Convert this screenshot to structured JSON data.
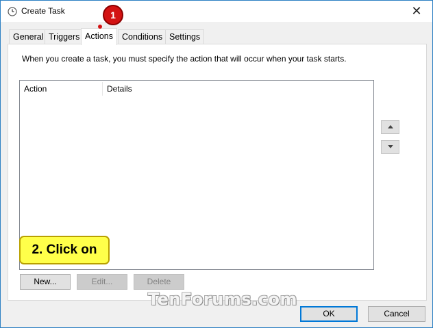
{
  "window": {
    "title": "Create Task",
    "close_glyph": "✕"
  },
  "tabs": [
    {
      "label": "General"
    },
    {
      "label": "Triggers"
    },
    {
      "label": "Actions",
      "active": true
    },
    {
      "label": "Conditions"
    },
    {
      "label": "Settings"
    }
  ],
  "panel": {
    "description": "When you create a task, you must specify the action that will occur when your task starts.",
    "columns": [
      "Action",
      "Details"
    ],
    "rows": []
  },
  "buttons": {
    "new": "New...",
    "edit": "Edit...",
    "delete": "Delete",
    "ok": "OK",
    "cancel": "Cancel"
  },
  "annotations": {
    "step1": "1",
    "step2": "2. Click on"
  },
  "watermark": "TenForums.com",
  "icons": {
    "title": "clock-icon",
    "move_up": "arrow-up-icon",
    "move_down": "arrow-down-icon"
  },
  "colors": {
    "accent": "#0078d7",
    "badge": "#d31212",
    "callout": "#ffff4a"
  }
}
